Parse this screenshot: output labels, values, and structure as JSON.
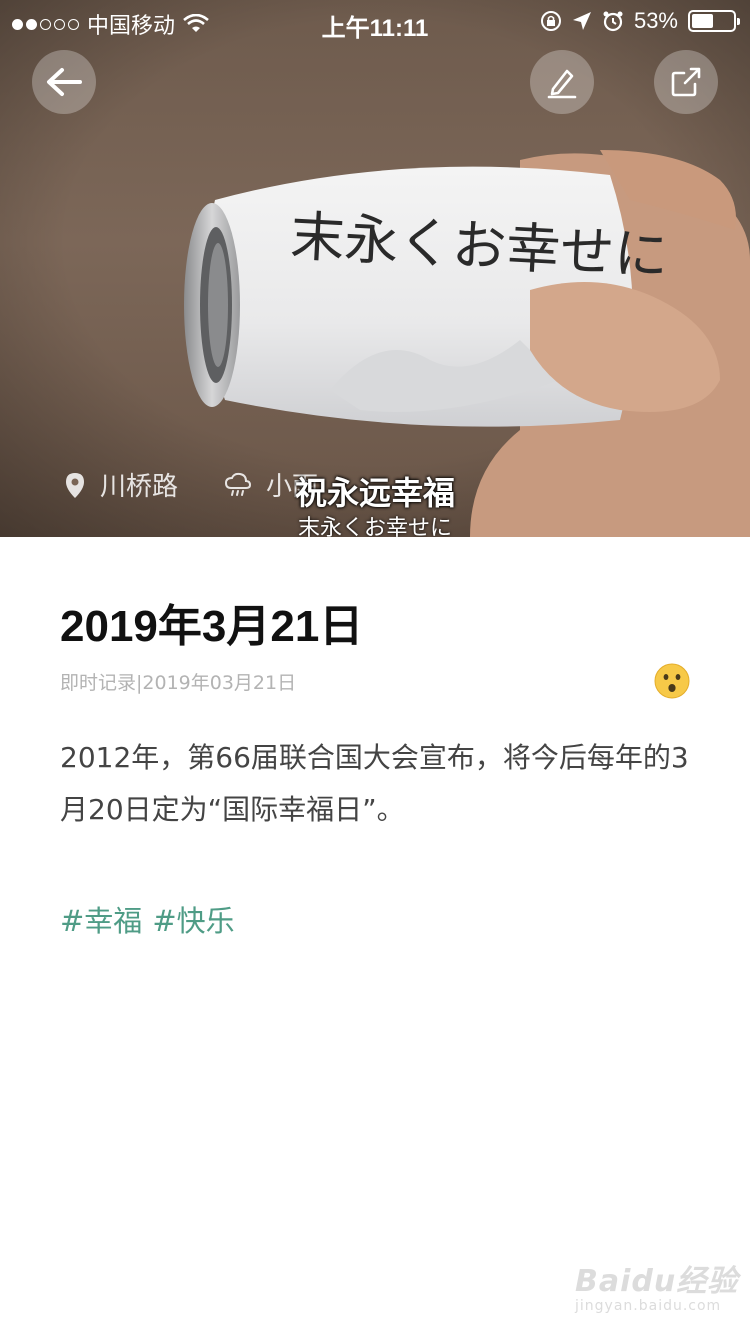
{
  "status_bar": {
    "carrier": "中国移动",
    "time": "上午11:11",
    "battery_percent": "53%",
    "battery_level": 0.53
  },
  "hero": {
    "can_text": "末永くお幸せに",
    "location": "川桥路",
    "weather": "小雨",
    "subtitle_zh": "祝永远幸福",
    "subtitle_jp": "末永くお幸せに"
  },
  "toolbar": {
    "back_icon": "arrow-left-icon",
    "edit_icon": "pencil-icon",
    "share_icon": "share-icon"
  },
  "entry": {
    "title": "2019年3月21日",
    "subinfo": "即时记录|2019年03月21日",
    "mood_icon": "surprised-face-icon",
    "body": "2012年，第66届联合国大会宣布，将今后每年的3月20日定为“国际幸福日”。",
    "tags": [
      "#幸福",
      "#快乐"
    ]
  },
  "watermark": {
    "brand": "Baidu经验",
    "url": "jingyan.baidu.com"
  },
  "colors": {
    "tag": "#4f9c86",
    "title": "#111111",
    "meta": "#b3b3b3"
  }
}
